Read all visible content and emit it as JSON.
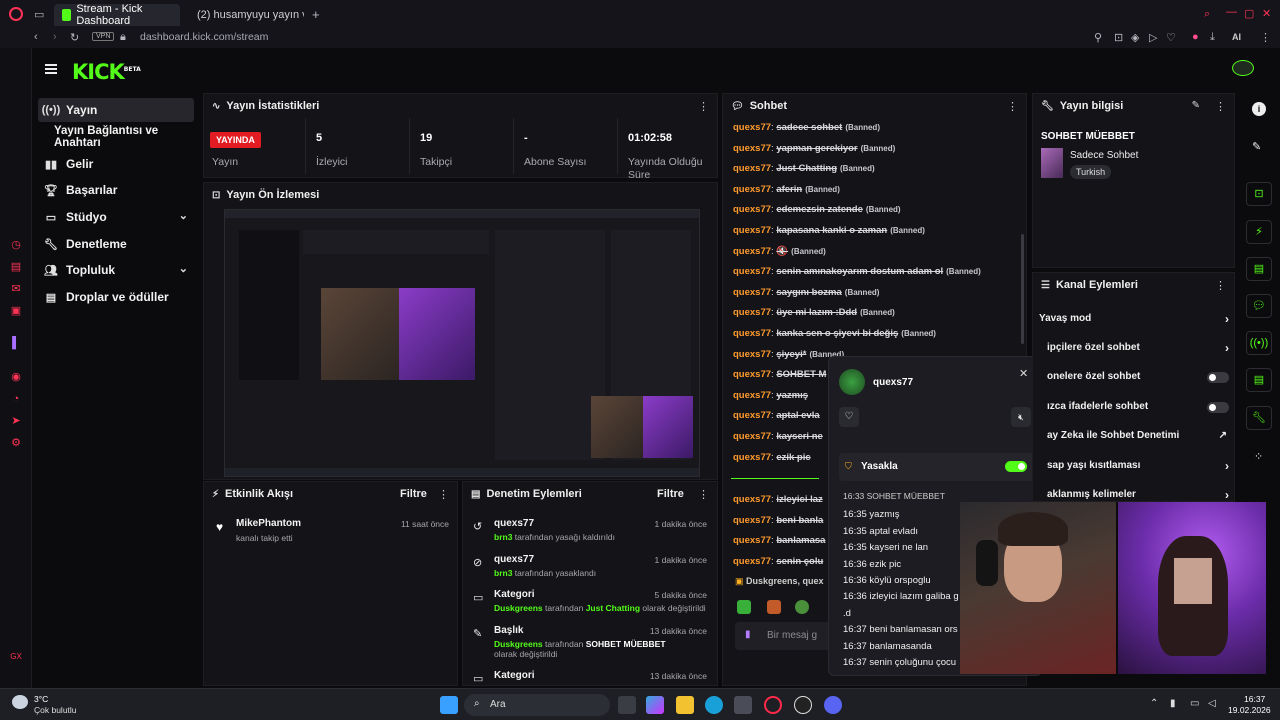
{
  "browser": {
    "tabs": [
      {
        "label": "Stream - Kick Dashboard",
        "active": true
      },
      {
        "label": "(2) husamyuyu yayın vakti",
        "active": false
      }
    ],
    "new_tab": "+",
    "vpn": "VPN",
    "url": "dashboard.kick.com/stream",
    "ai": "AI"
  },
  "brand": {
    "logo": "KICK",
    "beta": "BETA",
    "accent": "#53fc18"
  },
  "sidebar": {
    "items": [
      {
        "label": "Yayın",
        "icon": "broadcast-icon",
        "active": true
      },
      {
        "label": "Yayın Bağlantısı ve Anahtarı",
        "sub": true
      },
      {
        "label": "Gelir",
        "icon": "chart-icon"
      },
      {
        "label": "Başarılar",
        "icon": "trophy-icon"
      },
      {
        "label": "Stüdyo",
        "icon": "studio-icon",
        "expandable": true
      },
      {
        "label": "Denetleme",
        "icon": "wrench-icon"
      },
      {
        "label": "Topluluk",
        "icon": "people-icon",
        "expandable": true
      },
      {
        "label": "Droplar ve ödüller",
        "icon": "gift-icon"
      }
    ]
  },
  "stats": {
    "title": "Yayın İstatistikleri",
    "live": "YAYINDA",
    "items": [
      {
        "label": "Yayın",
        "value": ""
      },
      {
        "label": "İzleyici",
        "value": "5"
      },
      {
        "label": "Takipçi",
        "value": "19"
      },
      {
        "label": "Abone Sayısı",
        "value": "-"
      },
      {
        "label": "Yayında Olduğu Süre",
        "value": "01:02:58"
      }
    ]
  },
  "preview": {
    "title": "Yayın Ön İzlemesi"
  },
  "activity": {
    "title": "Etkinlik Akışı",
    "filter": "Filtre",
    "items": [
      {
        "user": "MikePhantom",
        "text": "kanalı takip etti",
        "time": "11 saat önce"
      }
    ]
  },
  "modlog": {
    "title": "Denetim Eylemleri",
    "filter": "Filtre",
    "items": [
      {
        "title": "quexs77",
        "actor": "brn3",
        "text": "tarafından yasağı kaldırıldı",
        "time": "1 dakika önce"
      },
      {
        "title": "quexs77",
        "actor": "brn3",
        "text": "tarafından yasaklandı",
        "time": "1 dakika önce"
      },
      {
        "title": "Kategori",
        "actor": "Duskgreens",
        "mid": "tarafından",
        "value": "Just Chatting",
        "text": "olarak değiştirildi",
        "time": "5 dakika önce"
      },
      {
        "title": "Başlık",
        "actor": "Duskgreens",
        "mid": "tarafından",
        "value": "SOHBET MÜEBBET",
        "text": "olarak değiştirildi",
        "time": "13 dakika önce"
      },
      {
        "title": "Kategori",
        "time": "13 dakika önce"
      }
    ]
  },
  "chat": {
    "title": "Sohbet",
    "banned_tag": "(Banned)",
    "messages": [
      {
        "user": "quexs77",
        "text": "sadece sohbet"
      },
      {
        "user": "quexs77",
        "text": "yapman gerekiyor"
      },
      {
        "user": "quexs77",
        "text": "Just Chatting"
      },
      {
        "user": "quexs77",
        "text": "aferin"
      },
      {
        "user": "quexs77",
        "text": "edemezsin zatende"
      },
      {
        "user": "quexs77",
        "text": "kapasana kanki o zaman"
      },
      {
        "user": "quexs77",
        "text": "🔇"
      },
      {
        "user": "quexs77",
        "text": "senin amınakoyarım dostum adam ol"
      },
      {
        "user": "quexs77",
        "text": "saygını bozma"
      },
      {
        "user": "quexs77",
        "text": "üye mi lazım :Ddd"
      },
      {
        "user": "quexs77",
        "text": "kanka sen o şiyevi bi değiş"
      },
      {
        "user": "quexs77",
        "text": "şiyeyi*"
      },
      {
        "user": "quexs77",
        "text": "SOHBET M"
      },
      {
        "user": "quexs77",
        "text": "yazmış"
      },
      {
        "user": "quexs77",
        "text": "aptal evla"
      },
      {
        "user": "quexs77",
        "text": "kayseri ne"
      },
      {
        "user": "quexs77",
        "text": "ezik pic"
      },
      {
        "user": "quexs77",
        "text": "izleyici laz"
      },
      {
        "user": "quexs77",
        "text": "beni banla"
      },
      {
        "user": "quexs77",
        "text": "banlamasa"
      },
      {
        "user": "quexs77",
        "text": "senin çolu"
      }
    ],
    "footer_user": "Duskgreens, quex",
    "input_placeholder": "Bir mesaj g"
  },
  "popup": {
    "user": "quexs77",
    "ban_label": "Yasakla",
    "lines": [
      "16:33 SOHBET MÜEBBET",
      "16:35 yazmış",
      "16:35 aptal evladı",
      "16:35 kayseri ne lan",
      "16:36 ezik pic",
      "16:36 köylü orspoglu",
      "16:36 izleyici lazım galiba g",
      ".d",
      "16:37 beni banlamasan ors",
      "16:37 banlamasanda",
      "16:37 senin çoluğunu çocu"
    ]
  },
  "info": {
    "title": "Yayın bilgisi",
    "stream_title": "SOHBET MÜEBBET",
    "category": "Sadece Sohbet",
    "language": "Turkish"
  },
  "channel_actions": {
    "title": "Kanal Eylemleri",
    "items": [
      {
        "label": "Yavaş mod",
        "control": "chevron"
      },
      {
        "label": "ipçilere özel sohbet",
        "control": "chevron"
      },
      {
        "label": "onelere özel sohbet",
        "control": "toggle"
      },
      {
        "label": "ızca ifadelerle sohbet",
        "control": "toggle"
      },
      {
        "label": "ay Zeka ile Sohbet Denetimi",
        "control": "external"
      },
      {
        "label": "sap yaşı kısıtlaması",
        "control": "chevron"
      },
      {
        "label": "aklanmış kelimeler",
        "control": "chevron"
      }
    ]
  },
  "taskbar": {
    "weather_temp": "3°C",
    "weather_text": "Çok bulutlu",
    "search": "Ara",
    "time": "16:37",
    "date": "19.02.2026"
  }
}
